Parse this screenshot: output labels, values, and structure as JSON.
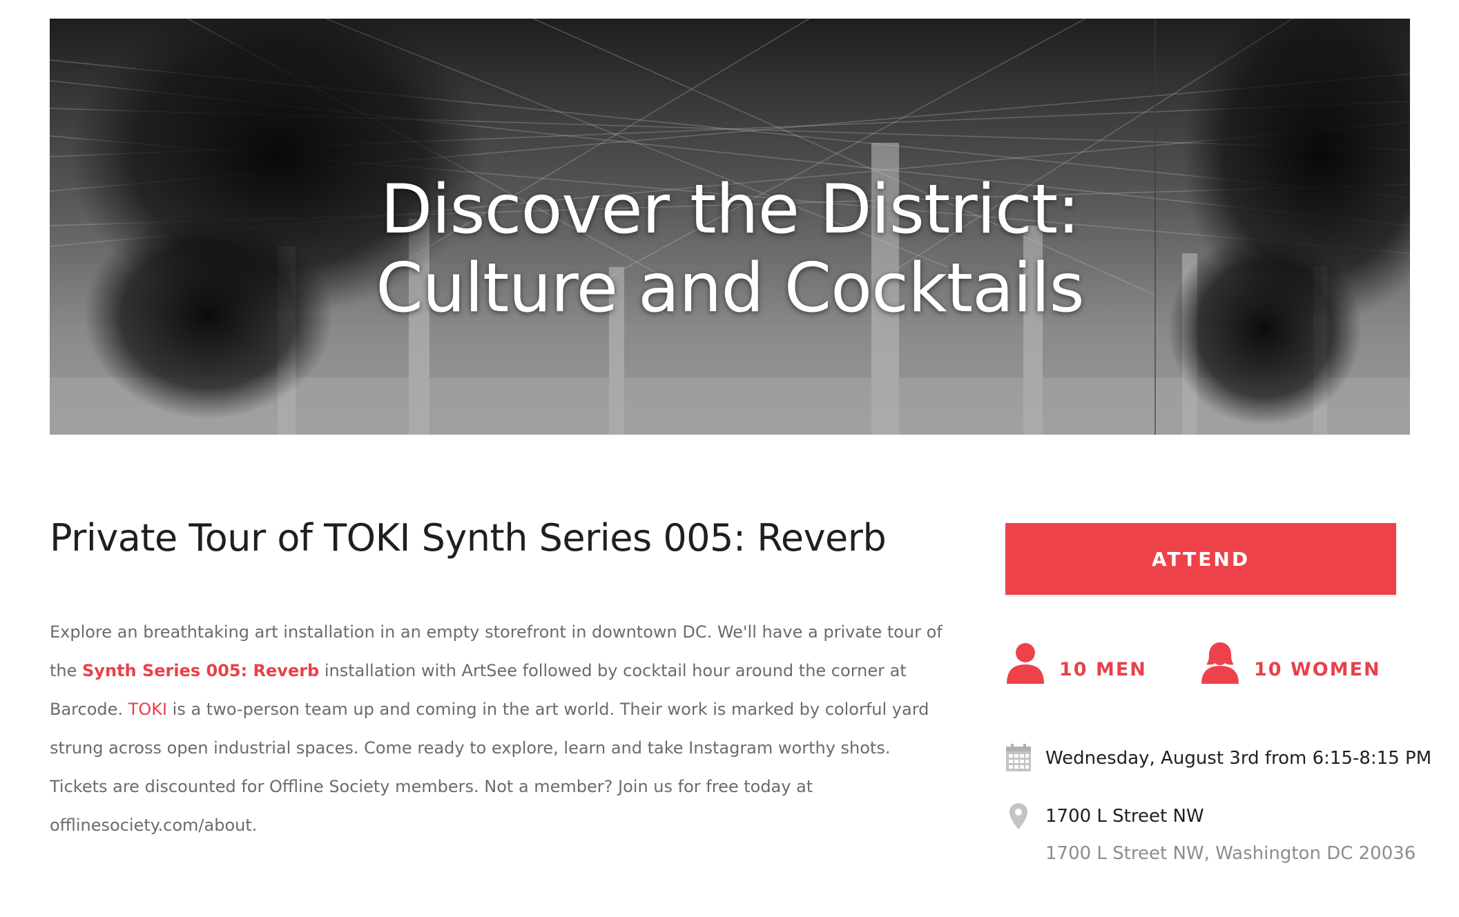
{
  "hero": {
    "title_line1": "Discover the District:",
    "title_line2": "Culture and Cocktails"
  },
  "event": {
    "title": "Private Tour of TOKI Synth Series 005: Reverb",
    "description": {
      "part1": "Explore an breathtaking art installation in an empty storefront in downtown DC. We'll have a private tour of the ",
      "link1": "Synth Series 005: Reverb",
      "part2": " installation with ArtSee followed by cocktail hour around the corner at Barcode. ",
      "link2": "TOKI",
      "part3": " is a two-person team up and coming in the art world. Their work is marked by colorful yard strung across open industrial spaces. Come ready to explore, learn and take Instagram worthy shots. Tickets are discounted for Offline Society members. Not a member? Join us for free today at offlinesociety.com/about."
    }
  },
  "sidebar": {
    "attend_label": "ATTEND",
    "men_label": "10 MEN",
    "women_label": "10 WOMEN",
    "date_text": "Wednesday, August 3rd from 6:15-8:15 PM",
    "venue_name": "1700 L Street NW",
    "venue_address": "1700 L Street NW, Washington DC 20036"
  },
  "colors": {
    "accent": "#ee424a",
    "text_dark": "#1f1f1f",
    "text_muted": "#6b6b6b",
    "icon_gray": "#b8b8b8"
  },
  "icons": {
    "men": "person-icon",
    "women": "person-female-icon",
    "date": "calendar-icon",
    "location": "map-pin-icon"
  }
}
